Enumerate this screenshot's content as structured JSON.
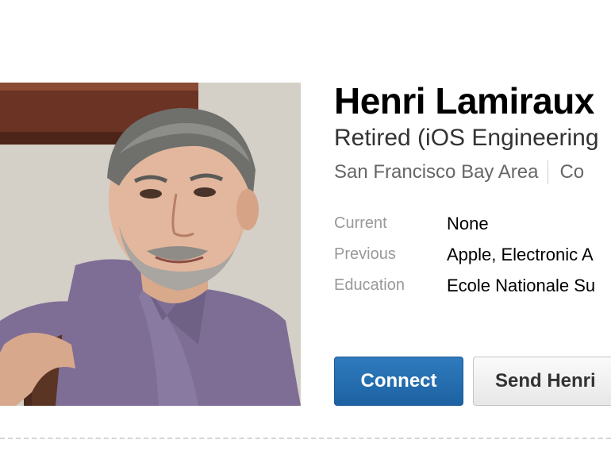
{
  "profile": {
    "name": "Henri Lamiraux",
    "headline": "Retired (iOS Engineering",
    "location": "San Francisco Bay Area",
    "industry": "Co"
  },
  "facts": [
    {
      "label": "Current",
      "value": "None"
    },
    {
      "label": "Previous",
      "value": "Apple, Electronic A"
    },
    {
      "label": "Education",
      "value": "Ecole Nationale Su"
    }
  ],
  "actions": {
    "connect_label": "Connect",
    "message_label": "Send Henri"
  },
  "colors": {
    "connect_button": "#1d62a3",
    "label_gray": "#999999"
  }
}
